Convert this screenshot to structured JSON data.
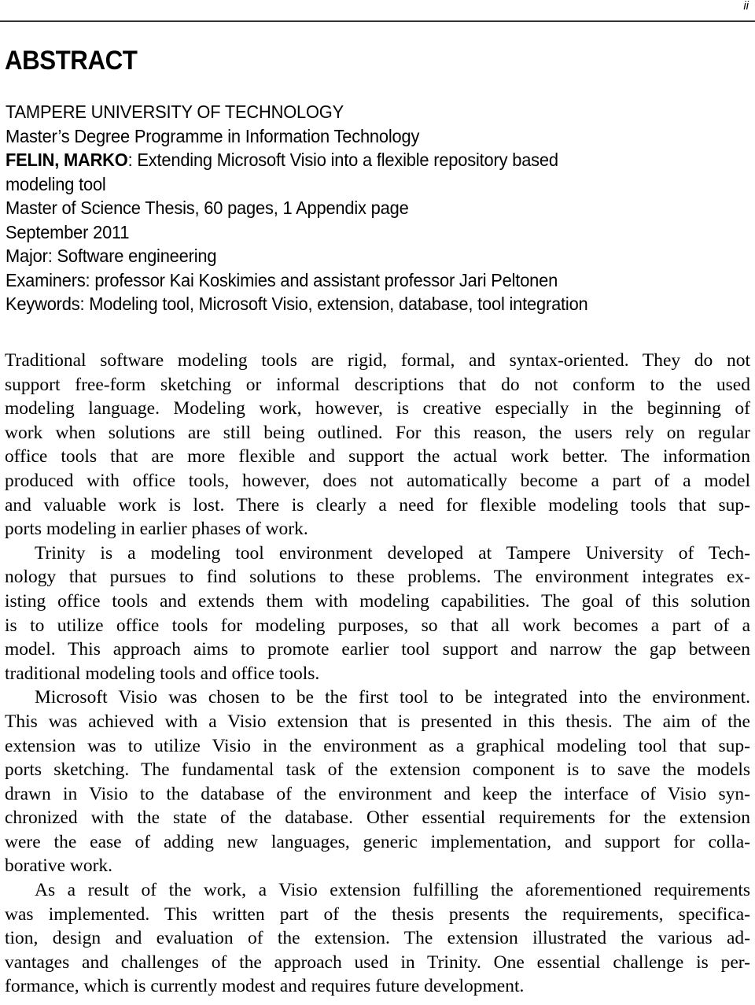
{
  "header": {
    "page_number": "ii"
  },
  "heading": "ABSTRACT",
  "meta": {
    "university": "TAMPERE UNIVERSITY OF TECHNOLOGY",
    "programme": "Master’s Degree Programme in Information Technology",
    "author": "FELIN, MARKO",
    "title_line_1": ": Extending Microsoft Visio into a flexible repository based",
    "title_line_2": "modeling tool",
    "thesis_info": "Master of Science Thesis, 60 pages, 1 Appendix page",
    "date": "September 2011",
    "major": "Major: Software engineering",
    "examiners": "Examiners: professor Kai Koskimies and assistant professor Jari Peltonen",
    "keywords": "Keywords: Modeling tool, Microsoft Visio, extension, database, tool integration"
  },
  "paragraphs": [
    {
      "lines": [
        "Traditional software modeling tools are rigid, formal, and syntax-oriented. They do not",
        "support free-form sketching or informal descriptions that do not conform to the used",
        "modeling language. Modeling work, however, is creative especially in the beginning of",
        "work when solutions are still being outlined. For this reason, the users rely on regular",
        "office tools that are more flexible and support the actual work better. The information",
        "produced with office tools, however, does not automatically become a part of a model",
        "and valuable work is lost. There is clearly a need for flexible modeling tools that sup-",
        "ports modeling in earlier phases of work."
      ]
    },
    {
      "lines": [
        "Trinity is a modeling tool environment developed at Tampere University of Tech-",
        "nology that pursues to find solutions to these problems. The environment integrates ex-",
        "isting office tools and extends them with modeling capabilities. The goal of this solution",
        "is to utilize office tools for modeling purposes, so that all work becomes a part of a",
        "model. This approach aims to promote earlier tool support and narrow the gap between",
        "traditional modeling tools and office tools."
      ]
    },
    {
      "lines": [
        "Microsoft Visio was chosen to be the first tool to be integrated into the environment.",
        "This was achieved with a Visio extension that is presented in this thesis. The aim of the",
        "extension was to utilize Visio in the environment as a graphical modeling tool that sup-",
        "ports sketching.  The fundamental task of the extension component is to save the models",
        "drawn in Visio to the database of the environment and keep the interface of Visio syn-",
        "chronized with the state of the database. Other essential requirements for the extension",
        "were the ease of adding new languages, generic implementation, and support for colla-",
        "borative work."
      ]
    },
    {
      "lines": [
        "As a result of the work, a Visio extension fulfilling the aforementioned requirements",
        "was implemented. This written part of the thesis presents the requirements, specifica-",
        "tion, design and evaluation of the extension. The extension illustrated the various ad-",
        "vantages and challenges of the approach used in Trinity. One essential challenge is per-",
        "formance, which is currently modest and requires future development."
      ]
    }
  ]
}
